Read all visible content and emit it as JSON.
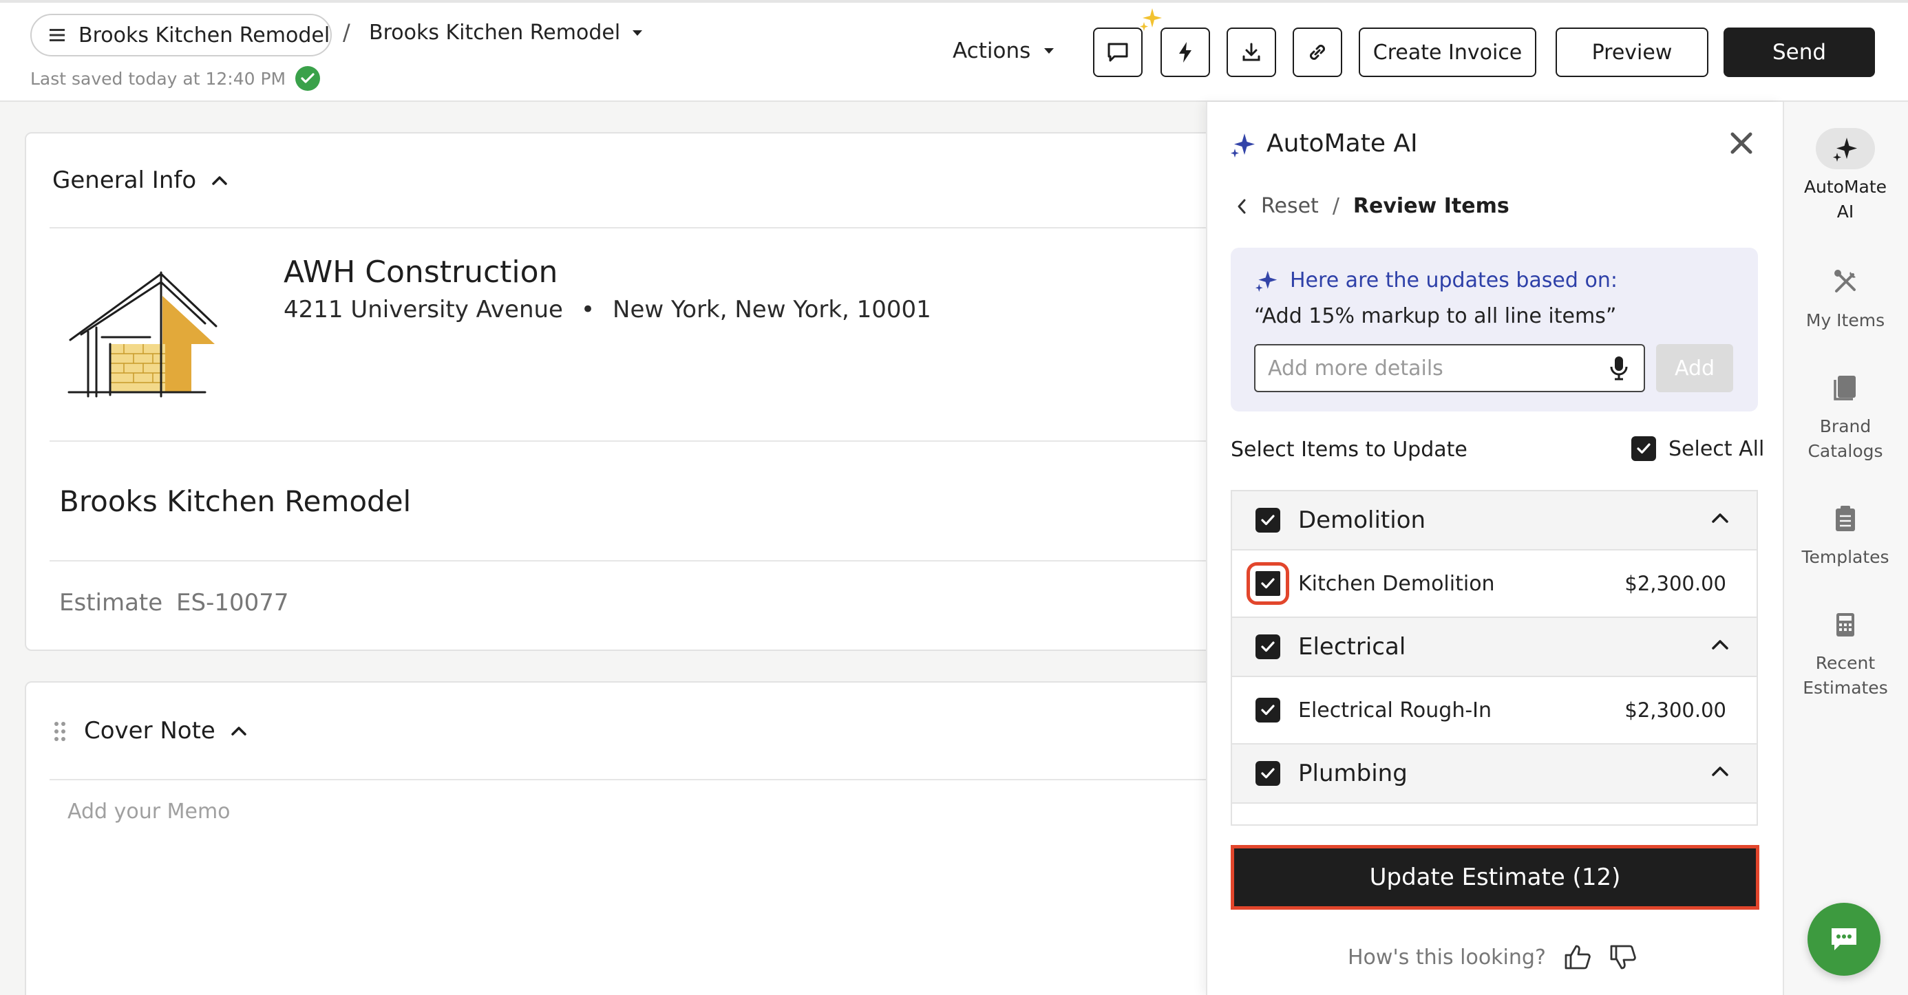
{
  "topbar": {
    "project_pill": "Brooks Kitchen Remodel",
    "breadcrumb_sep": "/",
    "breadcrumb_current": "Brooks Kitchen Remodel",
    "saved_status": "Last saved today at 12:40 PM",
    "actions_label": "Actions",
    "create_invoice_label": "Create Invoice",
    "preview_label": "Preview",
    "send_label": "Send"
  },
  "general_info": {
    "title": "General Info",
    "company_name": "AWH Construction",
    "street": "4211 University Avenue",
    "bullet": "•",
    "city_state_zip": "New York, New York, 10001",
    "project_title": "Brooks Kitchen Remodel",
    "estimate_label": "Estimate",
    "estimate_number": "ES-10077"
  },
  "cover_note": {
    "title": "Cover Note",
    "memo_placeholder": "Add your Memo"
  },
  "ai_panel": {
    "title": "AutoMate AI",
    "reset_label": "Reset",
    "crumb_sep": "/",
    "current_step": "Review Items",
    "updates_heading": "Here are the updates based on:",
    "prompt_quote": "“Add 15% markup to all line items”",
    "details_placeholder": "Add more details",
    "add_label": "Add",
    "select_items_label": "Select Items to Update",
    "select_all_label": "Select All",
    "groups": [
      {
        "name": "Demolition",
        "items": [
          {
            "name": "Kitchen Demolition",
            "price": "$2,300.00"
          }
        ]
      },
      {
        "name": "Electrical",
        "items": [
          {
            "name": "Electrical Rough-In",
            "price": "$2,300.00"
          }
        ]
      },
      {
        "name": "Plumbing",
        "items": []
      }
    ],
    "update_button_label": "Update Estimate (12)",
    "feedback_label": "How's this looking?"
  },
  "sidebar": {
    "automate_line1": "AutoMate",
    "automate_line2": "AI",
    "my_items": "My Items",
    "brand_line1": "Brand",
    "brand_line2": "Catalogs",
    "templates": "Templates",
    "recent_line1": "Recent",
    "recent_line2": "Estimates"
  },
  "colors": {
    "primary_dark": "#1e1e1e",
    "ai_accent": "#2e40a8",
    "highlight": "#e2462c",
    "success": "#3aa14a",
    "chat": "#3d9a3f"
  }
}
